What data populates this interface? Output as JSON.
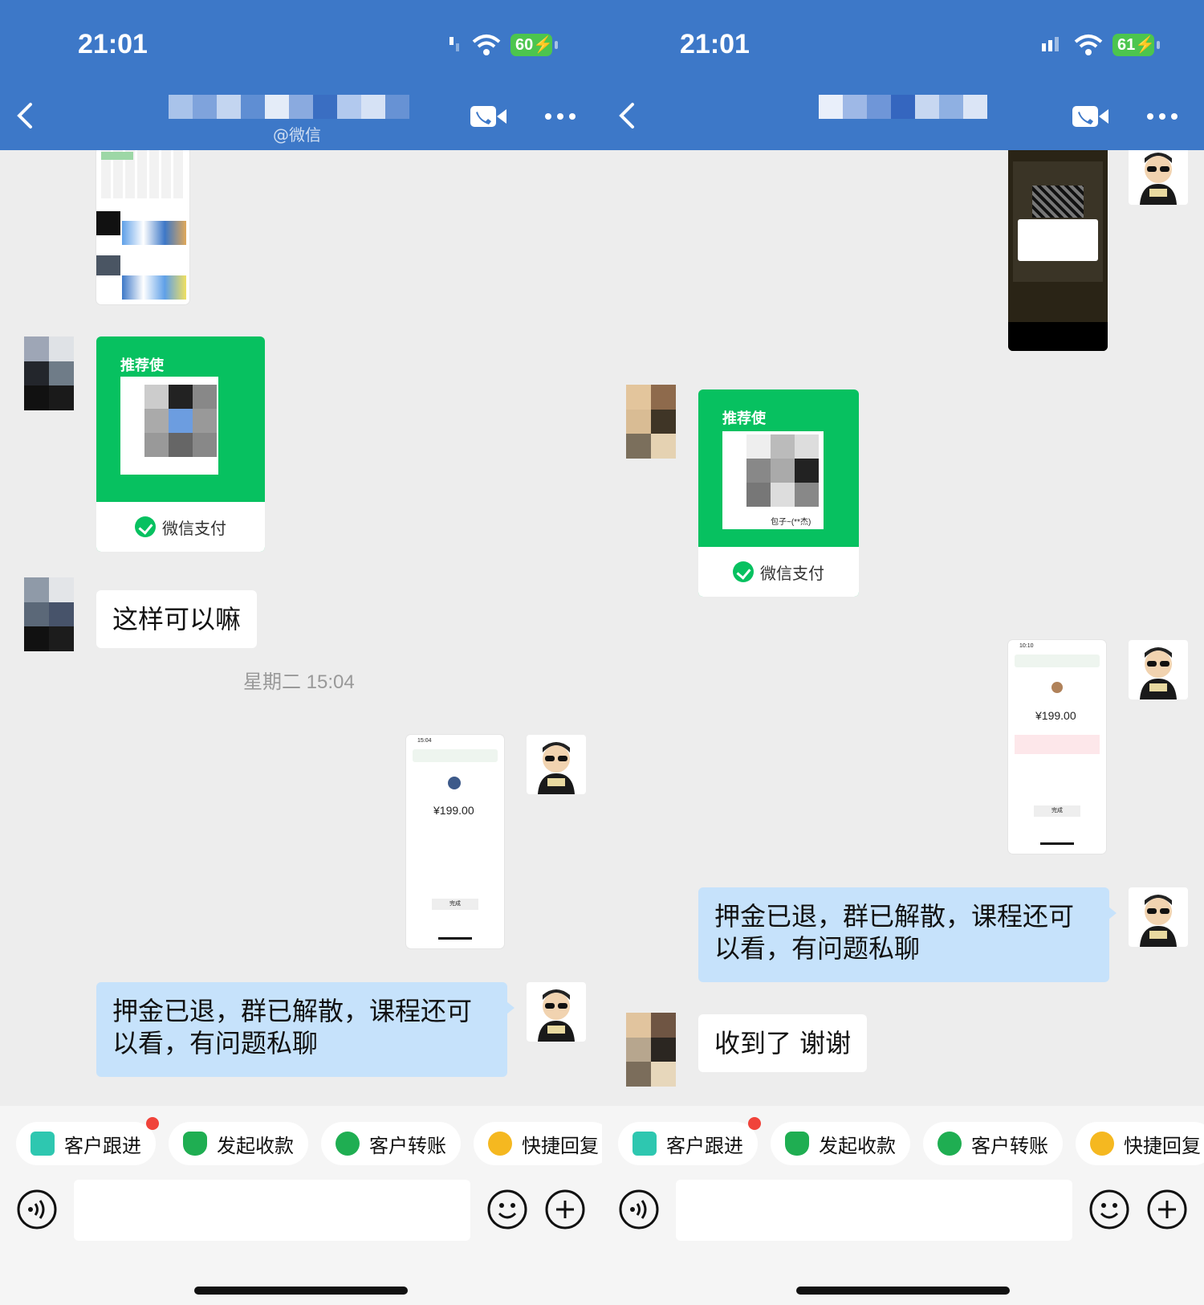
{
  "left": {
    "status": {
      "time": "21:01",
      "battery": "60"
    },
    "header": {
      "subtitle": "@微信"
    },
    "messages": {
      "qr_brand": "推荐使",
      "qr_pay_label": "微信支付",
      "incoming_text": "这样可以嘛",
      "timestamp": "星期二 15:04",
      "receipt_time": "15:04",
      "receipt_amount": "¥199.00",
      "receipt_button": "完成",
      "outgoing_text": "押金已退，群已解散，课程还可以看，有问题私聊"
    }
  },
  "right": {
    "status": {
      "time": "21:01",
      "battery": "61"
    },
    "messages": {
      "qr_brand": "推荐使",
      "qr_name": "包子~(**杰)",
      "qr_pay_label": "微信支付",
      "receipt_time": "10:10",
      "receipt_amount": "¥199.00",
      "receipt_button": "完成",
      "outgoing_text": "押金已退，群已解散，课程还可以看，有问题私聊",
      "incoming_text": "收到了 谢谢"
    }
  },
  "toolbar": {
    "chips": [
      "客户跟进",
      "发起收款",
      "客户转账",
      "快捷回复"
    ]
  },
  "colors": {
    "header": "#3d78c8",
    "wechat_green": "#07c160",
    "outgoing_bubble": "#c6e2fb",
    "badge_red": "#f0433a"
  },
  "icons": [
    "back-arrow-icon",
    "video-call-icon",
    "more-icon",
    "voice-icon",
    "emoji-icon",
    "plus-icon",
    "wechat-pay-icon"
  ]
}
